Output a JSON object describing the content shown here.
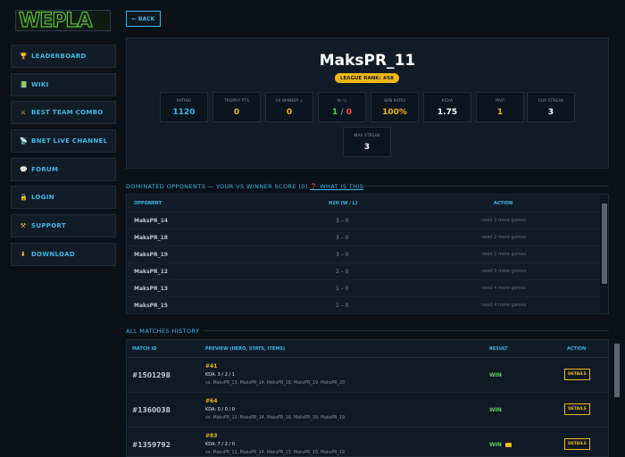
{
  "logo": {
    "text": "WEPLA"
  },
  "sidebar": {
    "items": [
      {
        "label": "LEADERBOARD",
        "icon": "trophy-icon",
        "glyph": "🏆"
      },
      {
        "label": "WIKI",
        "icon": "book-icon",
        "glyph": "📗"
      },
      {
        "label": "BEST TEAM COMBO",
        "icon": "swords-icon",
        "glyph": "⚔"
      },
      {
        "label": "BNET LIVE CHANNEL",
        "icon": "satellite-icon",
        "glyph": "📡"
      },
      {
        "label": "FORUM",
        "icon": "chat-icon",
        "glyph": "💬"
      },
      {
        "label": "LOGIN",
        "icon": "lock-icon",
        "glyph": "🔒"
      },
      {
        "label": "SUPPORT",
        "icon": "tools-icon",
        "glyph": "⚒"
      },
      {
        "label": "DOWNLOAD",
        "icon": "download-icon",
        "glyph": "⬇"
      }
    ]
  },
  "back_button": "← BACK",
  "profile": {
    "name": "MaksPR_11",
    "league_rank": "LEAGUE RANK: #58",
    "stats": [
      {
        "label": "RATING",
        "value": "1120",
        "color": "#3fb7ea"
      },
      {
        "label": "TROPHY PTS",
        "value": "0",
        "color": "#f0b715"
      },
      {
        "label": "VS WINNER ↓",
        "value": "0",
        "color": "#f0b715"
      },
      {
        "label": "W / L",
        "value_w": "1",
        "value_sep": " / ",
        "value_l": "0"
      },
      {
        "label": "WIN RATIO",
        "value": "100%",
        "color": "#f0b715"
      },
      {
        "label": "K/D/A",
        "value": "1.75",
        "color": "#ffffff"
      },
      {
        "label": "MVP",
        "value": "1",
        "color": "#f0b715"
      },
      {
        "label": "CUR STREAK",
        "value": "3",
        "color": "#ffffff"
      },
      {
        "label": "MAX STREAK",
        "value": "3",
        "color": "#ffffff"
      }
    ]
  },
  "dominated": {
    "title": "DOMINATED OPPONENTS — YOUR VS WINNER SCORE (0)",
    "what_link": "❓ WHAT IS THIS",
    "columns": [
      "OPPONENT",
      "H2H (W / L)",
      "ACTION"
    ],
    "rows": [
      {
        "opponent": "MaksPR_14",
        "h2h": "3 – 0",
        "action": "need 2 more games"
      },
      {
        "opponent": "MaksPR_18",
        "h2h": "3 – 0",
        "action": "need 2 more games"
      },
      {
        "opponent": "MaksPR_19",
        "h2h": "3 – 0",
        "action": "need 2 more games"
      },
      {
        "opponent": "MaksPR_12",
        "h2h": "2 – 0",
        "action": "need 3 more games"
      },
      {
        "opponent": "MaksPR_13",
        "h2h": "1 – 0",
        "action": "need 4 more games"
      },
      {
        "opponent": "MaksPR_15",
        "h2h": "1 – 0",
        "action": "need 4 more games"
      }
    ]
  },
  "history": {
    "title": "ALL MATCHES HISTORY",
    "columns": [
      "MATCH ID",
      "PREVIEW (HERO, STATS, ITEMS)",
      "RESULT",
      "ACTION"
    ],
    "rows": [
      {
        "id": "#1501298",
        "hero": "#41",
        "kda": "KDA: 3 / 2 / 1",
        "vs": "vs: MaksPR_13, MaksPR_14, MaksPR_18, MaksPR_19, MaksPR_20",
        "result": "WIN",
        "action": "DETAILS",
        "mvp": false
      },
      {
        "id": "#1360038",
        "hero": "#64",
        "kda": "KDA: 0 / 0 / 0",
        "vs": "vs: MaksPR_12, MaksPR_14, MaksPR_16, MaksPR_18, MaksPR_19",
        "result": "WIN",
        "action": "DETAILS",
        "mvp": false
      },
      {
        "id": "#1359792",
        "hero": "#83",
        "kda": "KDA: 7 / 2 / 0",
        "vs": "vs: MaksPR_12, MaksPR_14, MaksPR_15, MaksPR_18, MaksPR_19",
        "result": "WIN",
        "action": "DETAILS",
        "mvp": true
      }
    ]
  },
  "colors": {
    "accent": "#3fb7ea",
    "gold": "#f0b715",
    "win": "#5cd05a",
    "loss": "#ff4d4d"
  }
}
